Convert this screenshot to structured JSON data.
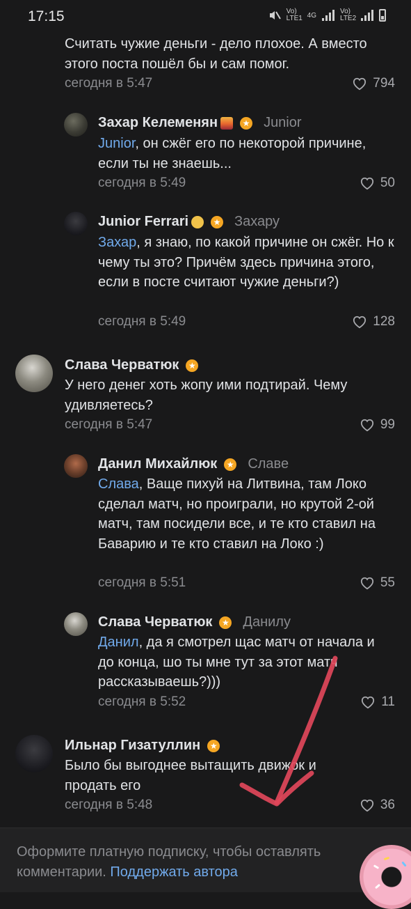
{
  "status_bar": {
    "time": "17:15",
    "net1": "Vo) LTE1",
    "net_type": "4G",
    "net2": "Vo) LTE2"
  },
  "comments": [
    {
      "text": "Считать чужие деньги - дело плохое. А вместо этого поста пошёл бы и сам помог.",
      "time": "сегодня в 5:47",
      "likes": "794"
    },
    {
      "name": "Захар Келеменян",
      "reply_to": "Junior",
      "mention": "Junior",
      "text": ", он сжёг его по некоторой причине, если ты не знаешь...",
      "time": "сегодня в 5:49",
      "likes": "50"
    },
    {
      "name": "Junior Ferrari",
      "reply_to": "Захару",
      "mention": "Захар",
      "text": ", я знаю, по какой причине он сжёг. Но к чему ты это? Причём здесь причина этого, если в посте считают чужие деньги?)",
      "time": "сегодня в 5:49",
      "likes": "128"
    },
    {
      "name": "Слава Черватюк",
      "text": "У него денег хоть жопу ими подтирай. Чему удивляетесь?",
      "time": "сегодня в 5:47",
      "likes": "99"
    },
    {
      "name": "Данил Михайлюк",
      "reply_to": "Славе",
      "mention": "Слава",
      "text": ", Ваще пихуй на Литвина, там Локо сделал матч, но проиграли, но крутой 2-ой матч, там посидели все, и те кто ставил на Баварию и те кто ставил на Локо :)",
      "time": "сегодня в 5:51",
      "likes": "55"
    },
    {
      "name": "Слава Черватюк",
      "reply_to": "Данилу",
      "mention": "Данил",
      "text": ", да я смотрел щас матч от начала и до конца, шо ты мне тут за этот матч рассказываешь?)))",
      "time": "сегодня в 5:52",
      "likes": "11"
    },
    {
      "name": "Ильнар Гизатуллин",
      "text": "Было бы выгоднее вытащить движок и продать его",
      "time": "сегодня в 5:48",
      "likes": "36"
    }
  ],
  "footer": {
    "text": "Оформите платную подписку, чтобы оставлять комментарии.",
    "link": "Поддержать автора"
  },
  "colors": {
    "background": "#19191a",
    "mention": "#71aaeb",
    "badge": "#f5a623",
    "arrow": "#e0475a"
  }
}
